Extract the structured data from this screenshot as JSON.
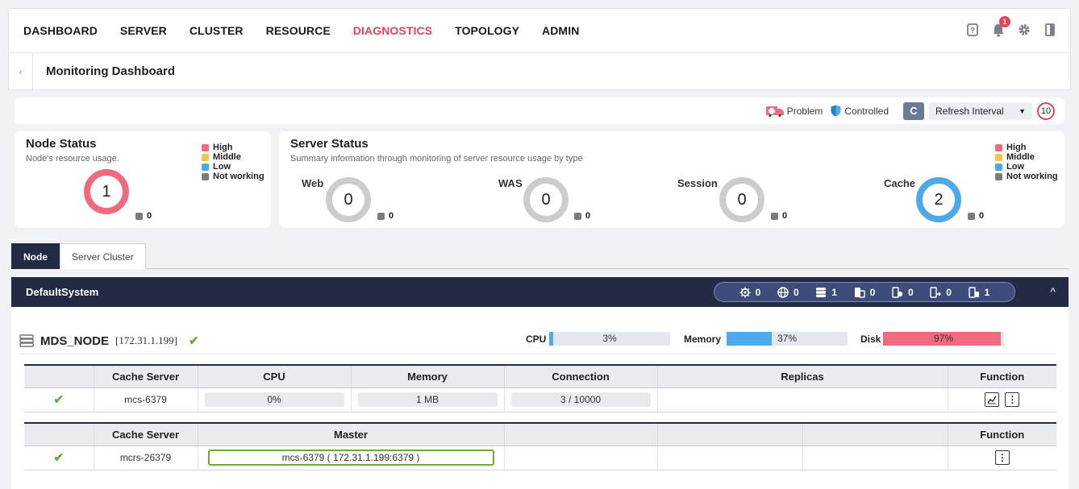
{
  "nav": {
    "items": [
      "DASHBOARD",
      "SERVER",
      "CLUSTER",
      "RESOURCE",
      "DIAGNOSTICS",
      "TOPOLOGY",
      "ADMIN"
    ],
    "active": "DIAGNOSTICS",
    "notification_count": "1"
  },
  "page": {
    "title": "Monitoring Dashboard"
  },
  "legend_bar": {
    "problem": "Problem",
    "controlled": "Controlled",
    "refresh_label": "Refresh Interval",
    "refresh_count": "10"
  },
  "legend_levels": [
    "High",
    "Middle",
    "Low",
    "Not working"
  ],
  "node_status": {
    "title": "Node Status",
    "subtitle": "Node's resource usage.",
    "count": "1",
    "not_working": "0"
  },
  "server_status": {
    "title": "Server Status",
    "subtitle": "Summary information through monitoring of server resource usage by type",
    "web": {
      "label": "Web",
      "count": "0",
      "not_working": "0"
    },
    "was": {
      "label": "WAS",
      "count": "0",
      "not_working": "0"
    },
    "session": {
      "label": "Session",
      "count": "0",
      "not_working": "0"
    },
    "cache": {
      "label": "Cache",
      "count": "2",
      "not_working": "0"
    }
  },
  "tabs": [
    "Node",
    "Server Cluster"
  ],
  "system": {
    "title": "DefaultSystem",
    "pill_counts": [
      "0",
      "0",
      "1",
      "0",
      "0",
      "0",
      "1"
    ]
  },
  "node": {
    "name": "MDS_NODE",
    "ip": "[172.31.1.199]",
    "cpu_label": "CPU",
    "cpu_text": "3%",
    "cpu_pct": 3,
    "memory_label": "Memory",
    "memory_text": "37%",
    "memory_pct": 37,
    "disk_label": "Disk",
    "disk_text": "97%",
    "disk_pct": 97
  },
  "cache_table": {
    "headers": [
      "",
      "Cache Server",
      "CPU",
      "Memory",
      "Connection",
      "Replicas",
      "Function"
    ],
    "row": {
      "name": "mcs-6379",
      "cpu": "0%",
      "memory": "1 MB",
      "connection": "3 / 10000"
    }
  },
  "master_table": {
    "headers": [
      "",
      "Cache Server",
      "Master",
      "",
      "",
      "",
      "Function"
    ],
    "row": {
      "name": "mcrs-26379",
      "master": "mcs-6379 ( 172.31.1.199:6379 )"
    }
  },
  "colors": {
    "high": "#f06a7e",
    "middle": "#f7c443",
    "low": "#4ea8ec",
    "not_working": "#7b7b7b",
    "active_nav": "#e8405a",
    "section_bg": "#222a44"
  }
}
